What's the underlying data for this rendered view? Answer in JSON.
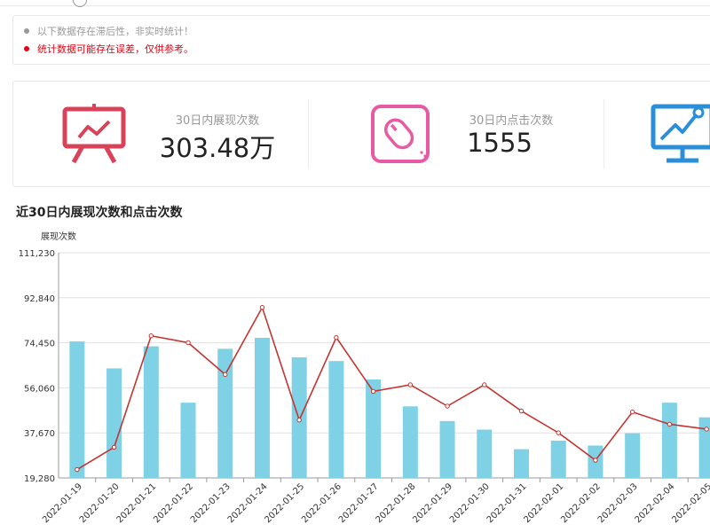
{
  "notices": [
    {
      "text": "以下数据存在滞后性，非实时统计！",
      "color": "#999999"
    },
    {
      "text": "统计数据可能存在误差，仅供参考。",
      "color": "#e60012"
    }
  ],
  "stats": [
    {
      "label": "30日内展现次数",
      "value": "303.48万",
      "icon": "presentation-chart-icon",
      "color": "#d9435a"
    },
    {
      "label": "30日内点击次数",
      "value": "1555",
      "icon": "mouse-icon",
      "color": "#e85aa4"
    },
    {
      "icon": "monitor-chart-icon",
      "color": "#2a8fd8"
    }
  ],
  "chart_title": "近30日内展现次数和点击次数",
  "chart_data": {
    "type": "bar",
    "ylabel": "展现次数",
    "ylim": [
      19280,
      111230
    ],
    "yticks": [
      "19,280",
      "37,670",
      "56,060",
      "74,450",
      "92,840",
      "111,230"
    ],
    "categories": [
      "2022-01-19",
      "2022-01-20",
      "2022-01-21",
      "2022-01-22",
      "2022-01-23",
      "2022-01-24",
      "2022-01-25",
      "2022-01-26",
      "2022-01-27",
      "2022-01-28",
      "2022-01-29",
      "2022-01-30",
      "2022-01-31",
      "2022-02-01",
      "2022-02-02",
      "2022-02-03",
      "2022-02-04",
      "2022-02-05"
    ],
    "series": [
      {
        "kind": "bar",
        "color": "#7fd1e6",
        "values": [
          75000,
          64000,
          73000,
          50000,
          72000,
          76500,
          68500,
          67000,
          59500,
          48500,
          42500,
          39000,
          31000,
          34500,
          32500,
          37500,
          50000,
          44000
        ]
      },
      {
        "kind": "line",
        "color": "#c23531",
        "values": [
          22700,
          31800,
          77300,
          74500,
          61500,
          88900,
          42900,
          76600,
          54600,
          57300,
          48600,
          57300,
          46600,
          37700,
          26500,
          46200,
          41200,
          39200
        ]
      }
    ],
    "grid": true
  }
}
